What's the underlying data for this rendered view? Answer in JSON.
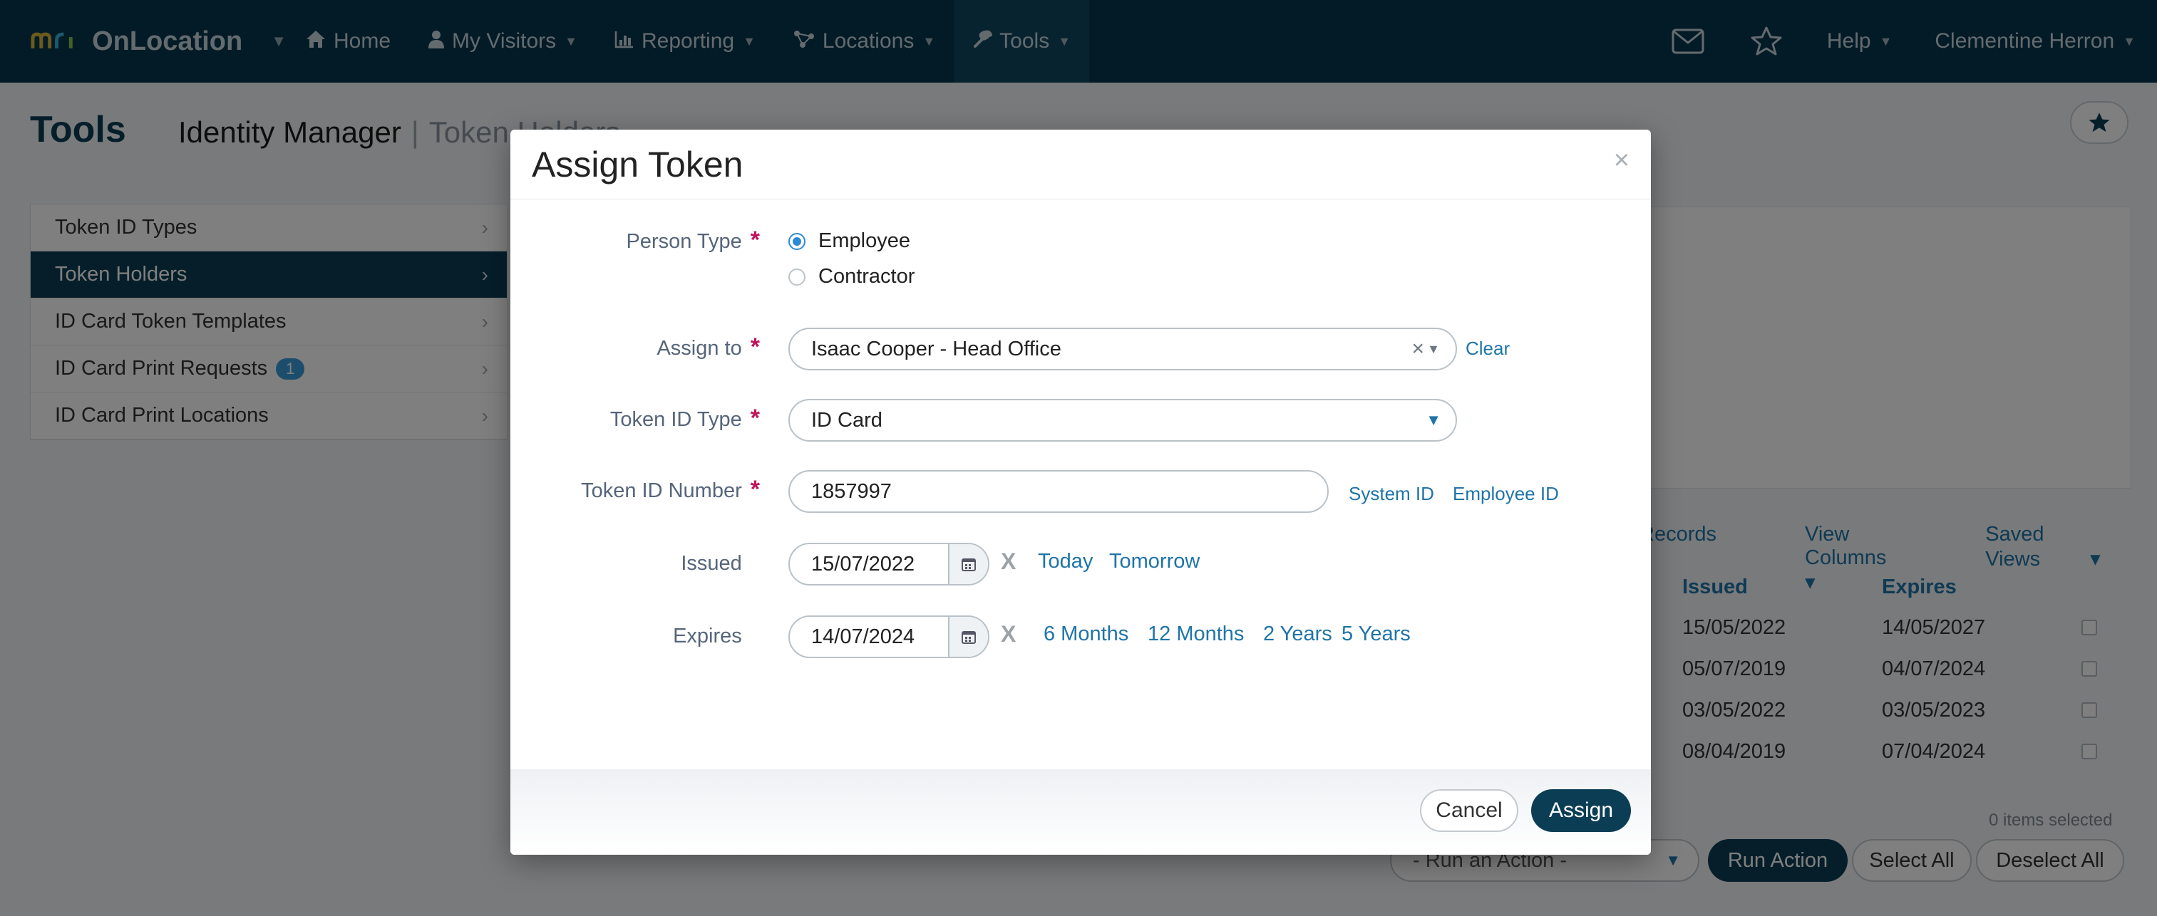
{
  "navbar": {
    "brand_name": "OnLocation",
    "items": [
      {
        "icon": "home-icon",
        "label": "Home"
      },
      {
        "icon": "user-icon",
        "label": "My Visitors"
      },
      {
        "icon": "bar-chart-icon",
        "label": "Reporting"
      },
      {
        "icon": "locations-icon",
        "label": "Locations"
      },
      {
        "icon": "wrench-icon",
        "label": "Tools"
      }
    ],
    "help_label": "Help",
    "user_name": "Clementine Herron",
    "icons": [
      "envelope-icon",
      "star-icon"
    ]
  },
  "page": {
    "title": "Tools",
    "subtitle": "Identity Manager",
    "crumb": "Token Holders"
  },
  "sidemenu": {
    "items": [
      {
        "label": "Token ID Types"
      },
      {
        "label": "Token Holders"
      },
      {
        "label": "ID Card Token Templates"
      },
      {
        "label": "ID Card Print Requests",
        "badge": "1"
      },
      {
        "label": "ID Card Print Locations"
      }
    ]
  },
  "table": {
    "toolbar": [
      "Records",
      "View Columns",
      "Saved Views"
    ],
    "headers": {
      "issued": "Issued",
      "expires": "Expires"
    },
    "rows": [
      {
        "issued": "15/05/2022",
        "expires": "14/05/2027"
      },
      {
        "issued": "05/07/2019",
        "expires": "04/07/2024"
      },
      {
        "issued": "03/05/2022",
        "expires": "03/05/2023"
      },
      {
        "issued": "08/04/2019",
        "expires": "07/04/2024"
      }
    ],
    "items_selected": "0 items selected",
    "action_placeholder": "- Run an Action -",
    "run_action_label": "Run Action",
    "select_all_label": "Select All",
    "deselect_all_label": "Deselect All"
  },
  "modal": {
    "title": "Assign Token",
    "close_glyph": "×",
    "person_type": {
      "label": "Person Type",
      "options": [
        "Employee",
        "Contractor"
      ],
      "selected": "Employee"
    },
    "assign_to": {
      "label": "Assign to",
      "value": "Isaac Cooper - Head Office",
      "clear_label": "Clear"
    },
    "token_id_type": {
      "label": "Token ID Type",
      "value": "ID Card"
    },
    "token_id_number": {
      "label": "Token ID Number",
      "value": "1857997",
      "system_id_label": "System ID",
      "employee_id_label": "Employee ID"
    },
    "issued": {
      "label": "Issued",
      "value": "15/07/2022",
      "quick": [
        "Today",
        "Tomorrow"
      ]
    },
    "expires": {
      "label": "Expires",
      "value": "14/07/2024",
      "quick": [
        "6 Months",
        "12 Months",
        "2 Years",
        "5 Years"
      ]
    },
    "cancel_label": "Cancel",
    "assign_label": "Assign"
  },
  "colors": {
    "navbar": "#06364d",
    "accent": "#0b3d55",
    "link": "#1f74a8",
    "required": "#c0145b",
    "radio": "#2b8ad6"
  }
}
